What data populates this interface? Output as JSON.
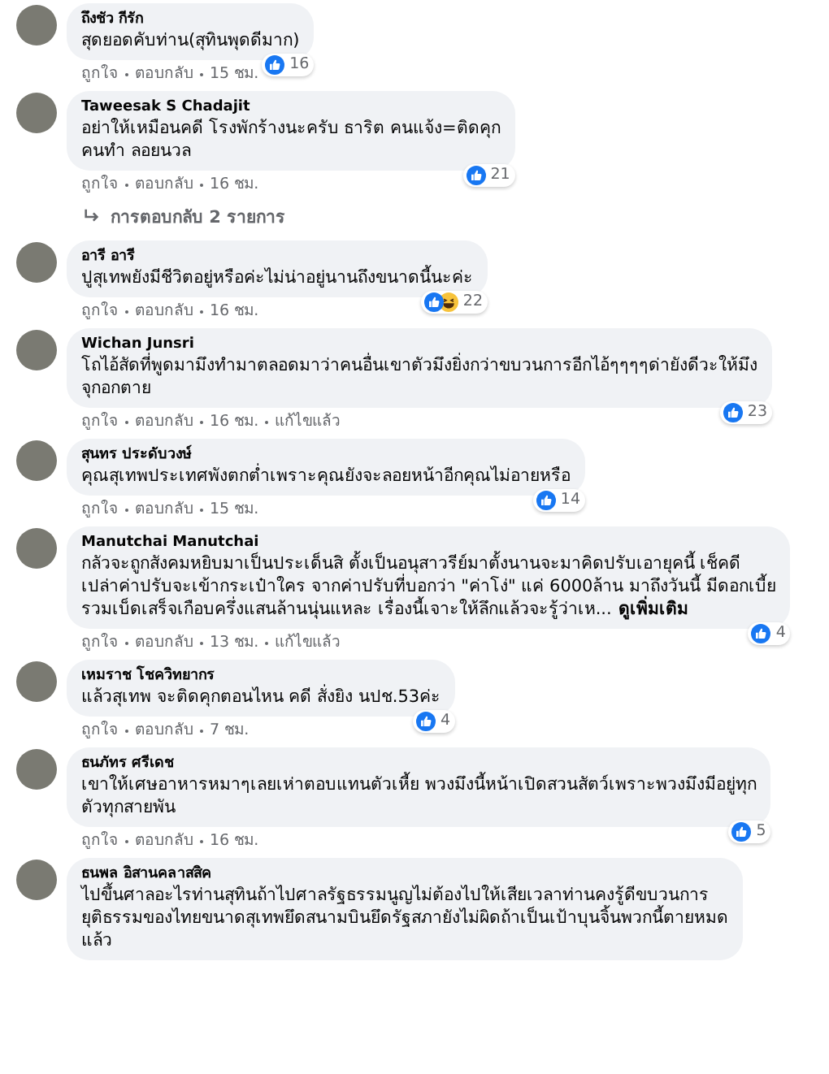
{
  "comments": [
    {
      "author": "ถึงชัว กีรัก",
      "text": "สุดยอดคับท่าน(สุทินพุดดีมาก)",
      "actions": {
        "like": "ถูกใจ",
        "reply": "ตอบกลับ",
        "time": "15 ชม."
      },
      "reactions": {
        "icons": [
          {
            "kind": "like"
          }
        ],
        "count": "16"
      }
    },
    {
      "author": "Taweesak S Chadajit",
      "text": "อย่าให้เหมือนคดี โรงพักร้างนะครับ ธาริต คนแจ้ง=ติดคุก\nคนทำ ลอยนวล",
      "actions": {
        "like": "ถูกใจ",
        "reply": "ตอบกลับ",
        "time": "16 ชม."
      },
      "reactions": {
        "icons": [
          {
            "kind": "like"
          }
        ],
        "count": "21"
      },
      "replies_link": "การตอบกลับ 2 รายการ"
    },
    {
      "author": "อารี อารี",
      "text": "ปูสุเทพยังมีชีวิตอยู่หรือค่ะไม่น่าอยู่นานถึงขนาดนี้นะค่ะ",
      "actions": {
        "like": "ถูกใจ",
        "reply": "ตอบกลับ",
        "time": "16 ชม."
      },
      "reactions": {
        "icons": [
          {
            "kind": "like"
          },
          {
            "kind": "haha"
          }
        ],
        "count": "22"
      }
    },
    {
      "author": "Wichan Junsri",
      "text": "โถไอ้สัดที่พูดมามึงทำมาตลอดมาว่าคนอื่นเขาตัวมึงยิ่งกว่าขบวนการอีกไอ้ๆๆๆๆด่ายังดีวะให้มึง\nจุกอกตาย",
      "actions": {
        "like": "ถูกใจ",
        "reply": "ตอบกลับ",
        "time": "16 ชม.",
        "edited": "แก้ไขแล้ว"
      },
      "reactions": {
        "icons": [
          {
            "kind": "like"
          }
        ],
        "count": "23"
      }
    },
    {
      "author": "สุนทร ประดับวงษ์",
      "text": "คุณสุเทพประเทศพังตกต่ำเพราะคุณยังจะลอยหน้าอีกคุณไม่อายหรือ",
      "actions": {
        "like": "ถูกใจ",
        "reply": "ตอบกลับ",
        "time": "15 ชม."
      },
      "reactions": {
        "icons": [
          {
            "kind": "like"
          }
        ],
        "count": "14"
      }
    },
    {
      "author": "Manutchai Manutchai",
      "text": "กลัวจะถูกสังคมหยิบมาเป็นประเด็นสิ ตั้งเป็นอนุสาวรีย์มาตั้งนานจะมาคิดปรับเอายุคนี้ เช็คดี\nเปล่าค่าปรับจะเข้ากระเป๋าใคร จากค่าปรับที่บอกว่า \"ค่าโง่\" แค่ 6000ล้าน มาถึงวันนี้ มีดอกเบี้ย\nรวมเบ็ดเสร็จเกือบครึ่งแสนล้านนุ่นแหละ เรื่องนี้เจาะให้ลึกแล้วจะรู้ว่าเห...",
      "see_more": "ดูเพิ่มเติม",
      "actions": {
        "like": "ถูกใจ",
        "reply": "ตอบกลับ",
        "time": "13 ชม.",
        "edited": "แก้ไขแล้ว"
      },
      "reactions": {
        "icons": [
          {
            "kind": "like"
          }
        ],
        "count": "4"
      }
    },
    {
      "author": "เหมราช โชควิทยากร",
      "text": "แล้วสุเทพ จะติดคุกตอนไหน คดี สั่งยิง นปช.53ค่ะ",
      "actions": {
        "like": "ถูกใจ",
        "reply": "ตอบกลับ",
        "time": "7 ชม."
      },
      "reactions": {
        "icons": [
          {
            "kind": "like"
          }
        ],
        "count": "4"
      }
    },
    {
      "author": "ธนภัทร ศรีเดช",
      "text": "เขาให้เศษอาหารหมาๆเลยเห่าตอบแทนตัวเหี้ย พวงมึงนี้หน้าเปิดสวนสัตว์เพราะพวงมึงมีอยู่ทุก\nตัวทุกสายพัน",
      "actions": {
        "like": "ถูกใจ",
        "reply": "ตอบกลับ",
        "time": "16 ชม."
      },
      "reactions": {
        "icons": [
          {
            "kind": "like"
          }
        ],
        "count": "5"
      }
    },
    {
      "author": "ธนพล อิสานคลาสสิค",
      "text": "ไปขึ้นศาลอะไรท่านสุทินถ้าไปศาลรัฐธรรมนูญไม่ต้องไปให้เสียเวลาท่านคงรู้ดีขบวนการ\nยุติธรรมของไทยขนาดสุเทพยึดสนามบินยึดรัฐสภายังไม่ผิดถ้าเป็นเป้าบุนจิ้นพวกนี้ตายหมด\nแล้ว"
    }
  ]
}
